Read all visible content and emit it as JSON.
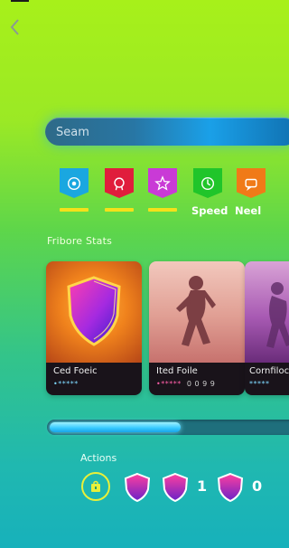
{
  "search": {
    "placeholder": "Seam"
  },
  "categories": [
    {
      "icon": "target-icon",
      "color": "#1aa7e0",
      "label": "",
      "underline": true
    },
    {
      "icon": "medal-icon",
      "color": "#e01d3c",
      "label": "",
      "underline": true
    },
    {
      "icon": "star-icon",
      "color": "#c93ad6",
      "label": "",
      "underline": true
    },
    {
      "icon": "clock-icon",
      "color": "#20c52a",
      "label": "Speed",
      "underline": false
    },
    {
      "icon": "chat-icon",
      "color": "#f07a18",
      "label": "Neel",
      "underline": false
    }
  ],
  "section": {
    "title": "Fribore Stats"
  },
  "cards": [
    {
      "title": "Ced Foeic",
      "meta": "•*****",
      "extra": "",
      "image": "shield-icon"
    },
    {
      "title": "Ited Foile",
      "meta": "•*****",
      "extra": "0 0 9 9",
      "image": "runner-silhouette"
    },
    {
      "title": "Cornfiloc",
      "meta": "*****",
      "extra": "",
      "image": "runner-silhouette"
    }
  ],
  "progress": {
    "percent": 53
  },
  "actions": {
    "label": "Actions",
    "items": [
      {
        "icon": "bag-icon"
      },
      {
        "icon": "shield-icon"
      },
      {
        "icon": "shield-icon",
        "count": "1"
      },
      {
        "icon": "shield-icon",
        "count": "0"
      }
    ]
  },
  "colors": {
    "accent": "#1aa0e8",
    "highlight": "#f4e11a"
  }
}
